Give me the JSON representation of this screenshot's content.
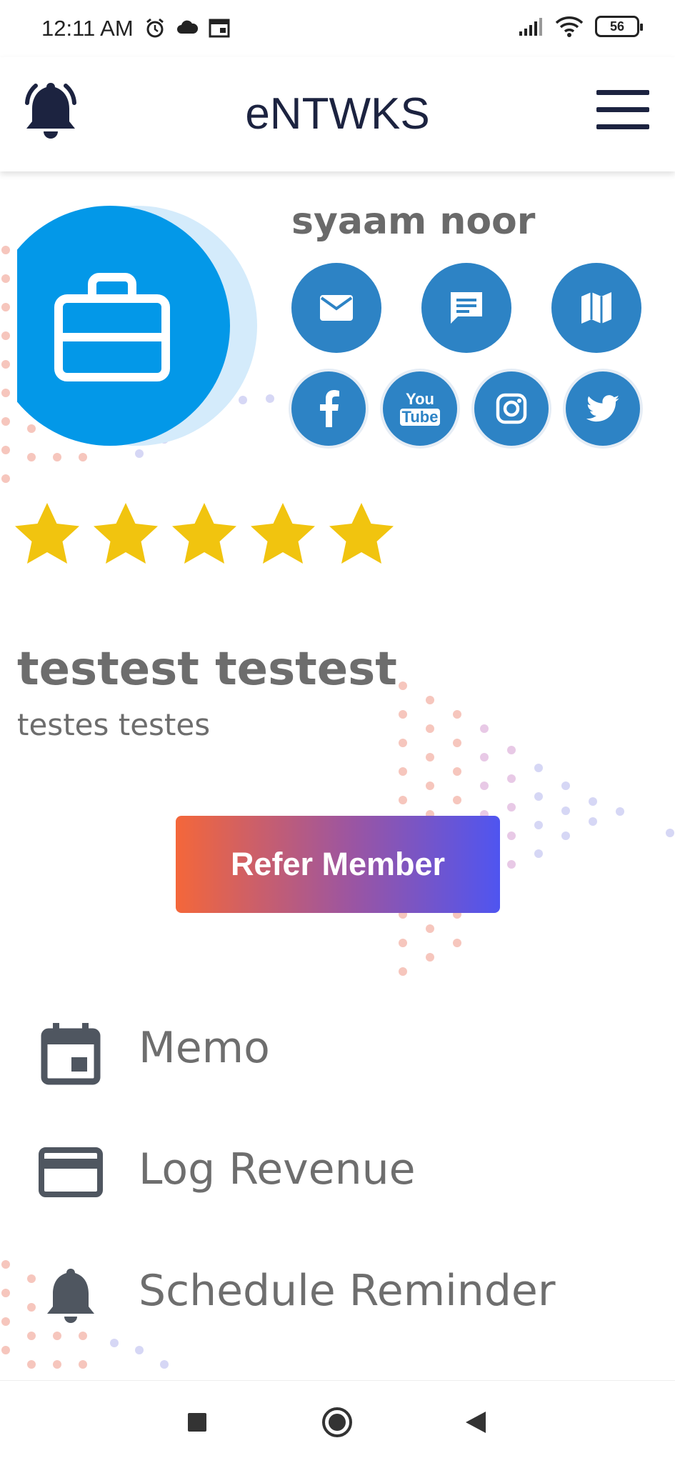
{
  "status_bar": {
    "time": "12:11 AM",
    "battery": "56",
    "icons": [
      "alarm-icon",
      "cloud-icon",
      "calendar-icon",
      "signal-icon",
      "wifi-icon",
      "battery-icon"
    ]
  },
  "header": {
    "title": "eNTWKS",
    "notification_icon": "bell-icon",
    "menu_icon": "hamburger-menu-icon"
  },
  "profile": {
    "name": "syaam noor",
    "avatar_icon": "briefcase-icon",
    "contact_buttons": [
      {
        "icon": "mail-icon"
      },
      {
        "icon": "message-icon"
      },
      {
        "icon": "map-icon"
      }
    ],
    "social_buttons": [
      {
        "icon": "facebook-icon"
      },
      {
        "icon": "youtube-icon",
        "label_top": "You",
        "label_bottom": "Tube"
      },
      {
        "icon": "instagram-icon"
      },
      {
        "icon": "twitter-icon"
      }
    ],
    "rating": 5,
    "rating_max": 5,
    "full_name": "testest testest",
    "subtitle": "testes testes"
  },
  "actions": {
    "refer_label": "Refer Member"
  },
  "menu": [
    {
      "label": "Memo",
      "icon": "calendar-icon"
    },
    {
      "label": "Log Revenue",
      "icon": "credit-card-icon"
    },
    {
      "label": "Schedule Reminder",
      "icon": "bell-icon"
    }
  ],
  "colors": {
    "accent": "#2d83c5",
    "avatar_bg": "#0398e8",
    "star": "#f1c40f",
    "title": "#1c2340",
    "gradient_start": "#f4673a",
    "gradient_end": "#4f55f0"
  }
}
